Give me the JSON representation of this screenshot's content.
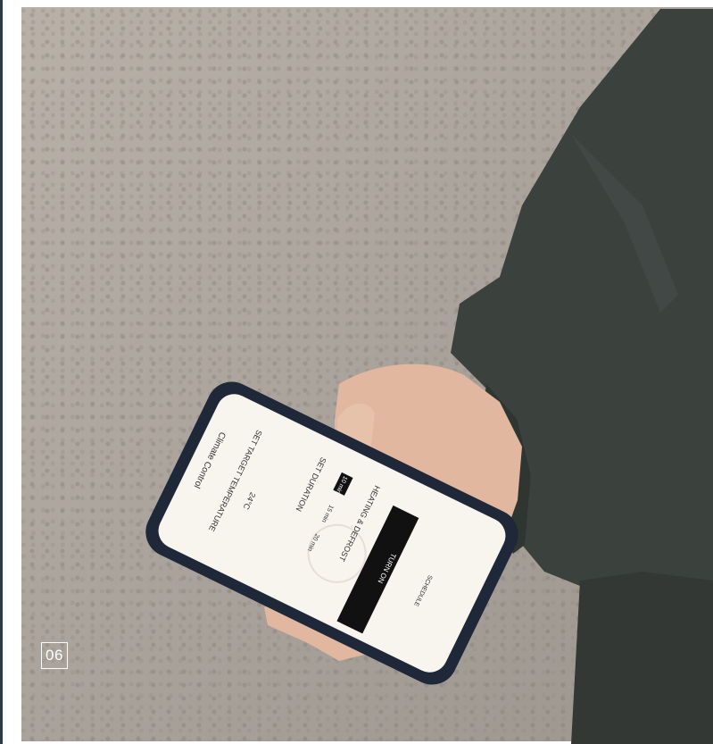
{
  "image": {
    "description_tag": "photo",
    "badge_number": "06"
  },
  "phone_ui": {
    "header_title": "Climate Control",
    "section_temperature": "SET TARGET TEMPERATURE",
    "temperature_value": "24°C",
    "section_duration": "SET DURATION",
    "duration_options": [
      "10 min",
      "15 min",
      "20 min"
    ],
    "duration_selected": "10 min",
    "section_heating": "HEATING & DEFROST",
    "primary_button": "TURN ON",
    "secondary_button": "SCHEDULE"
  },
  "colors": {
    "gravel": "#aaa39c",
    "jacket": "#3b413d",
    "phone_case": "#1f2838",
    "screen": "#f8f4ee",
    "primary_button": "#111111"
  }
}
